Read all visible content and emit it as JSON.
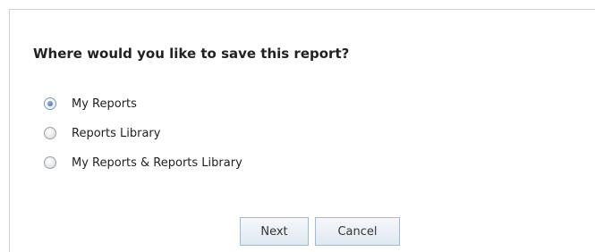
{
  "dialog": {
    "title": "Where would you like to save this report?",
    "options": [
      {
        "label": "My Reports",
        "selected": true
      },
      {
        "label": "Reports Library",
        "selected": false
      },
      {
        "label": "My Reports & Reports Library",
        "selected": false
      }
    ],
    "buttons": {
      "next_label": "Next",
      "cancel_label": "Cancel"
    }
  },
  "colors": {
    "border": "#cfcfcf",
    "radio_accent": "#4f7fb6",
    "button_border": "#a9b8c9"
  }
}
